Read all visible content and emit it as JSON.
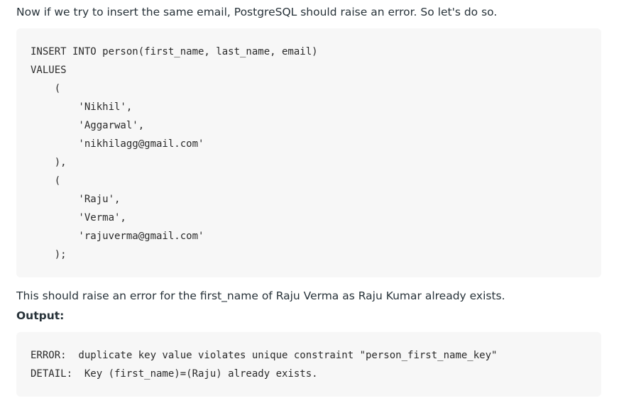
{
  "article": {
    "intro": "Now if we try to insert the same email, PostgreSQL should raise an error. So let's do so.",
    "code_lines": [
      "INSERT INTO person(first_name, last_name, email)",
      "VALUES",
      "    (",
      "        'Nikhil',",
      "        'Aggarwal',",
      "        'nikhilagg@gmail.com'",
      "    ),",
      "    (",
      "        'Raju',",
      "        'Verma',",
      "        'rajuverma@gmail.com'",
      "    );"
    ],
    "explanation": "This should raise an error for the first_name of Raju Verma as Raju Kumar already exists.",
    "output_label": "Output:",
    "output_lines": [
      "ERROR:  duplicate key value violates unique constraint \"person_first_name_key\"",
      "DETAIL:  Key (first_name)=(Raju) already exists."
    ]
  }
}
